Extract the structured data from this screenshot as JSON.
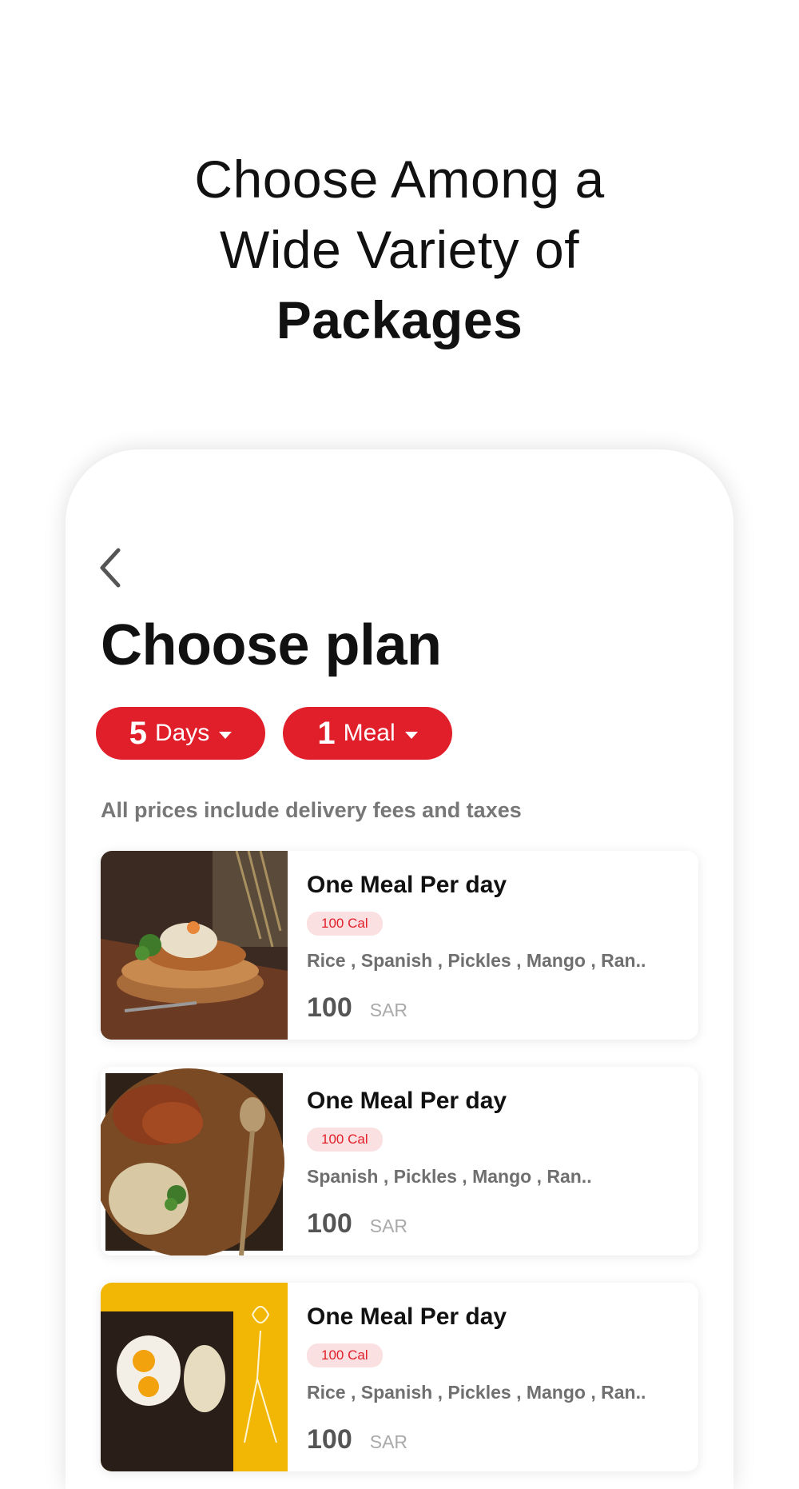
{
  "hero": {
    "line1": "Choose Among a",
    "line2": "Wide Variety of",
    "line3": "Packages"
  },
  "screen": {
    "title": "Choose plan",
    "filters": {
      "days": {
        "number": "5",
        "label": "Days"
      },
      "meals": {
        "number": "1",
        "label": "Meal"
      }
    },
    "note": "All prices include delivery fees and taxes"
  },
  "plans": [
    {
      "name": "One Meal Per day",
      "calories": "100 Cal",
      "ingredients": "Rice , Spanish , Pickles  , Mango  , Ran..",
      "price": "100",
      "currency": "SAR"
    },
    {
      "name": "One Meal Per day",
      "calories": "100 Cal",
      "ingredients": "Spanish , Pickles  , Mango  , Ran..",
      "price": "100",
      "currency": "SAR"
    },
    {
      "name": "One Meal Per day",
      "calories": "100 Cal",
      "ingredients": "Rice , Spanish , Pickles  , Mango  , Ran..",
      "price": "100",
      "currency": "SAR"
    }
  ],
  "colors": {
    "accent": "#e11f2a",
    "calorie_badge_bg": "#fbe0e1",
    "muted_text": "#777777"
  },
  "icons": {
    "back": "chevron-left-icon",
    "dropdown": "caret-down-icon"
  }
}
